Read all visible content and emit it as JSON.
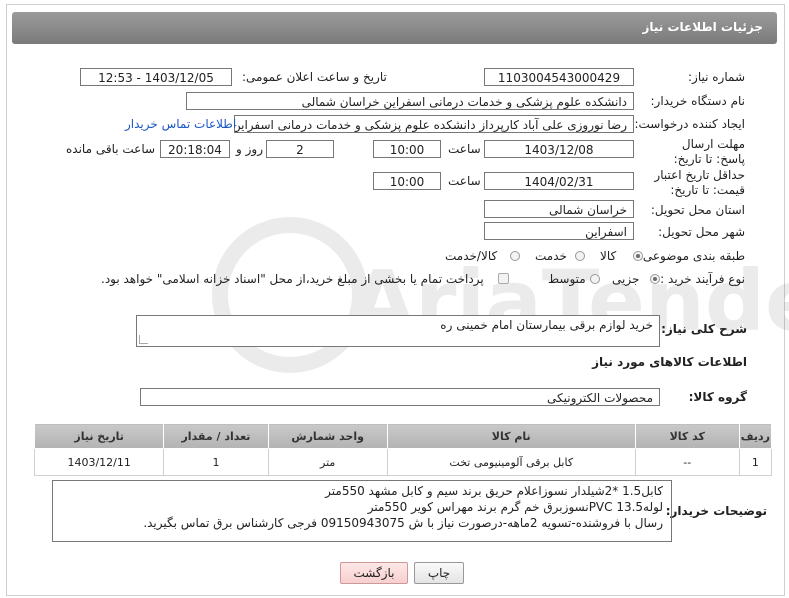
{
  "header": {
    "title": "جزئیات اطلاعات نیاز"
  },
  "fields": {
    "need_number": {
      "label": "شماره نیاز:",
      "value": "1103004543000429"
    },
    "announce_datetime": {
      "label": "تاریخ و ساعت اعلان عمومی:",
      "value": "1403/12/05 - 12:53"
    },
    "buyer_org": {
      "label": "نام دستگاه خریدار:",
      "value": "دانشکده علوم پزشکی و خدمات درمانی اسفراین خراسان شمالی"
    },
    "requester": {
      "label": "ایجاد کننده درخواست:",
      "value": "رضا نوروزی علی آباد کارپرداز  دانشکده علوم پزشکی و خدمات درمانی اسفراین خ",
      "contact_link": "اطلاعات تماس خریدار"
    },
    "reply_deadline": {
      "label": "مهلت ارسال پاسخ: تا تاریخ:",
      "date": "1403/12/08",
      "time_label": "ساعت",
      "time": "10:00",
      "days": "2",
      "days_label": "روز و",
      "remaining": "20:18:04",
      "remaining_label": "ساعت باقی مانده"
    },
    "price_validity": {
      "label": "حداقل تاریخ اعتبار قیمت: تا تاریخ:",
      "date": "1404/02/31",
      "time_label": "ساعت",
      "time": "10:00"
    },
    "province": {
      "label": "استان محل تحویل:",
      "value": "خراسان شمالی"
    },
    "city": {
      "label": "شهر محل تحویل:",
      "value": "اسفراین"
    },
    "category": {
      "label": "طبقه بندی موضوعی:",
      "options": [
        "کالا",
        "خدمت",
        "کالا/خدمت"
      ],
      "selected": "کالا"
    },
    "purchase_type": {
      "label": "نوع فرآیند خرید :",
      "options": [
        "جزیی",
        "متوسط"
      ],
      "selected": "جزیی",
      "checkbox_text": "پرداخت تمام یا بخشی از مبلغ خرید،از محل \"اسناد خزانه اسلامی\" خواهد بود."
    }
  },
  "summary": {
    "label": "شرح کلی نیاز:",
    "value": "خرید لوازم برقی بیمارستان امام خمینی ره"
  },
  "goods_section": {
    "title": "اطلاعات کالاهای مورد نیاز",
    "group_label": "گروه کالا:",
    "group_value": "محصولات الکترونیکی"
  },
  "table": {
    "headers": [
      "ردیف",
      "کد کالا",
      "نام کالا",
      "واحد شمارش",
      "تعداد / مقدار",
      "تاریخ نیاز"
    ],
    "rows": [
      [
        "1",
        "--",
        "کابل برقی آلومینیومی تخت",
        "متر",
        "1",
        "1403/12/11"
      ]
    ]
  },
  "buyer_notes": {
    "label": "توضیحات خریدار:",
    "lines": [
      "کابل1.5 *2شیلدار نسوزاعلام حریق برند سیم و کابل مشهد  550متر",
      "لولهPVC 13.5نسوزبرق خم گرم برند مهراس کویر  550متر",
      "رسال با فروشنده-تسویه 2ماهه-درصورت نیاز با ش 09150943075 فرجی کارشناس برق تماس بگیرید."
    ]
  },
  "buttons": {
    "print": "چاپ",
    "back": "بازگشت"
  },
  "watermark": "AriaTender.neT"
}
